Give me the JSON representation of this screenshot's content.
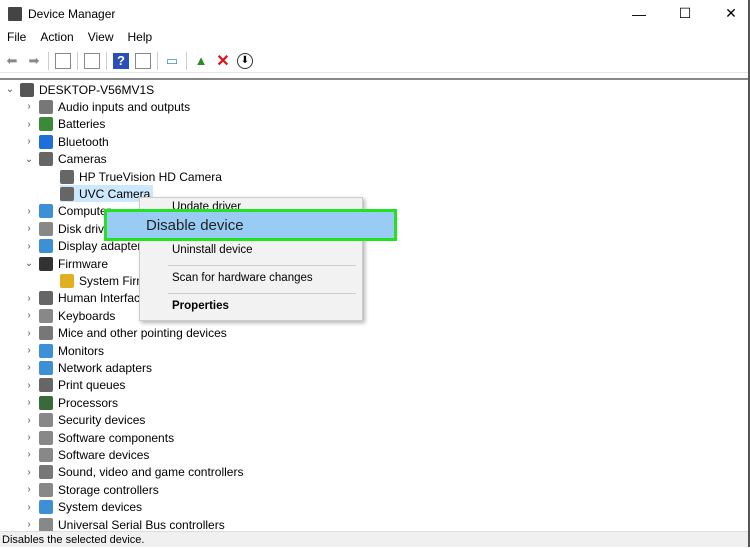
{
  "window": {
    "title": "Device Manager",
    "minimize": "—",
    "maximize": "☐",
    "close": "✕"
  },
  "menu": [
    "File",
    "Action",
    "View",
    "Help"
  ],
  "toolbar": [
    "back-icon",
    "forward-icon",
    "show-hide-tree-icon",
    "properties-icon",
    "help-icon",
    "action-icon",
    "scan-hardware-icon",
    "update-driver-icon",
    "uninstall-icon",
    "disable-icon"
  ],
  "tree": [
    {
      "label": "DESKTOP-V56MV1S",
      "level": 0,
      "expander": "⌄",
      "icon": "#555555"
    },
    {
      "label": "Audio inputs and outputs",
      "level": 1,
      "expander": "›",
      "icon": "#777777"
    },
    {
      "label": "Batteries",
      "level": 1,
      "expander": "›",
      "icon": "#3a8a3a"
    },
    {
      "label": "Bluetooth",
      "level": 1,
      "expander": "›",
      "icon": "#1e6fd9"
    },
    {
      "label": "Cameras",
      "level": 1,
      "expander": "⌄",
      "icon": "#666666"
    },
    {
      "label": "HP TrueVision HD Camera",
      "level": 2,
      "expander": "",
      "icon": "#666666"
    },
    {
      "label": "UVC Camera",
      "level": 2,
      "expander": "",
      "icon": "#666666",
      "selected": true
    },
    {
      "label": "Computer",
      "level": 1,
      "expander": "›",
      "icon": "#3d8fd6"
    },
    {
      "label": "Disk drives",
      "level": 1,
      "expander": "›",
      "icon": "#888888"
    },
    {
      "label": "Display adapters",
      "level": 1,
      "expander": "›",
      "icon": "#3d8fd6"
    },
    {
      "label": "Firmware",
      "level": 1,
      "expander": "⌄",
      "icon": "#333333"
    },
    {
      "label": "System Firmware",
      "level": 2,
      "expander": "",
      "icon": "#e0b020"
    },
    {
      "label": "Human Interface Devices",
      "level": 1,
      "expander": "›",
      "icon": "#666666"
    },
    {
      "label": "Keyboards",
      "level": 1,
      "expander": "›",
      "icon": "#888888"
    },
    {
      "label": "Mice and other pointing devices",
      "level": 1,
      "expander": "›",
      "icon": "#777777"
    },
    {
      "label": "Monitors",
      "level": 1,
      "expander": "›",
      "icon": "#3d8fd6"
    },
    {
      "label": "Network adapters",
      "level": 1,
      "expander": "›",
      "icon": "#3d8fd6"
    },
    {
      "label": "Print queues",
      "level": 1,
      "expander": "›",
      "icon": "#666666"
    },
    {
      "label": "Processors",
      "level": 1,
      "expander": "›",
      "icon": "#3a6a3a"
    },
    {
      "label": "Security devices",
      "level": 1,
      "expander": "›",
      "icon": "#888888"
    },
    {
      "label": "Software components",
      "level": 1,
      "expander": "›",
      "icon": "#888888"
    },
    {
      "label": "Software devices",
      "level": 1,
      "expander": "›",
      "icon": "#888888"
    },
    {
      "label": "Sound, video and game controllers",
      "level": 1,
      "expander": "›",
      "icon": "#777777"
    },
    {
      "label": "Storage controllers",
      "level": 1,
      "expander": "›",
      "icon": "#888888"
    },
    {
      "label": "System devices",
      "level": 1,
      "expander": "›",
      "icon": "#3d8fd6"
    },
    {
      "label": "Universal Serial Bus controllers",
      "level": 1,
      "expander": "›",
      "icon": "#888888"
    }
  ],
  "context_menu": {
    "update": "Update driver",
    "disable": "Disable device",
    "uninstall": "Uninstall device",
    "scan": "Scan for hardware changes",
    "properties": "Properties"
  },
  "status": "Disables the selected device.",
  "colors": {
    "highlight": "#99ccf5",
    "highlight_border": "#22e322",
    "selected": "#cce8ff"
  }
}
